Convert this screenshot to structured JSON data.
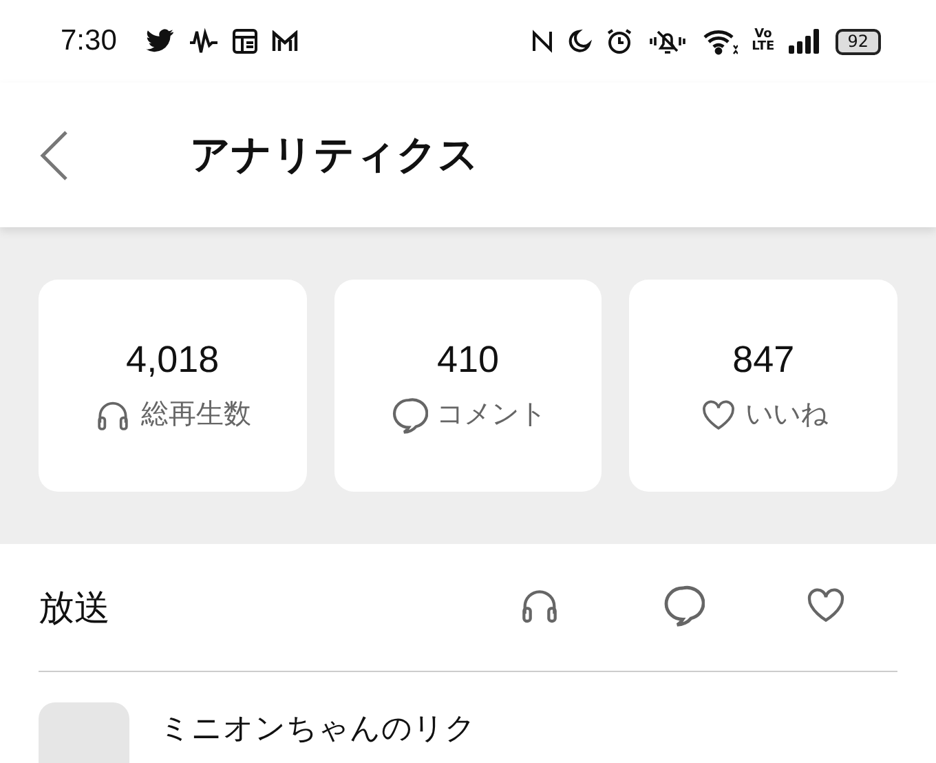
{
  "status_bar": {
    "time": "7:30",
    "network_label": "Vo\nLTE",
    "battery": "92"
  },
  "header": {
    "title": "アナリティクス"
  },
  "stats": [
    {
      "kind": "plays",
      "value": "4,018",
      "label": "総再生数"
    },
    {
      "kind": "comments",
      "value": "410",
      "label": "コメント"
    },
    {
      "kind": "likes",
      "value": "847",
      "label": "いいね"
    }
  ],
  "broadcasts": {
    "title": "放送",
    "columns": [
      {
        "kind": "plays"
      },
      {
        "kind": "comments"
      },
      {
        "kind": "likes"
      }
    ],
    "rows": [
      {
        "title": "ミニオンちゃんのリク"
      }
    ]
  }
}
